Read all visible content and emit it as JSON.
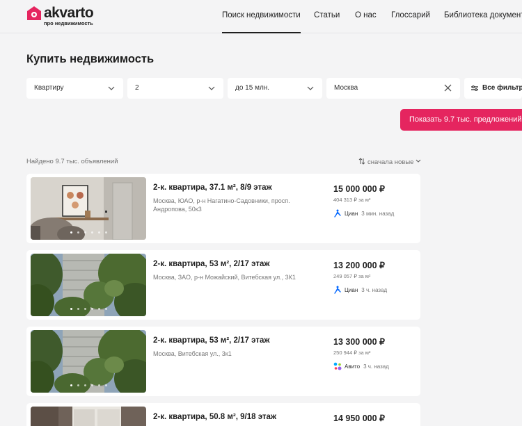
{
  "header": {
    "logo_text": "akvarto",
    "logo_sub": "про недвижимость",
    "nav": [
      "Поиск недвижимости",
      "Статьи",
      "О нас",
      "Глоссарий",
      "Библиотека документо"
    ]
  },
  "page_title": "Купить недвижимость",
  "filters": {
    "type": "Квартиру",
    "rooms": "2",
    "price": "до 15 млн.",
    "city": "Москва",
    "all_filters": "Все фильтры"
  },
  "show_button": "Показать 9.7 тыс. предложений",
  "found_text": "Найдено 9.7 тыс. объявлений",
  "sort_label": "сначала новые",
  "colors": {
    "accent": "#e5255f",
    "cian": "#0468ff"
  },
  "listings": [
    {
      "title": "2-к. квартира, 37.1 м², 8/9 этаж",
      "address": "Москва, ЮАО, р-н Нагатино-Садовники, просп. Андропова, 50к3",
      "price": "15 000 000 ₽",
      "price_per_m2": "404 313 ₽ за м²",
      "source": "Циан",
      "time": "3 мин. назад",
      "source_icon": "cian-icon"
    },
    {
      "title": "2-к. квартира, 53 м², 2/17 этаж",
      "address": "Москва, ЗАО, р-н Можайский, Витебская ул., 3К1",
      "price": "13 200 000 ₽",
      "price_per_m2": "249 057 ₽ за м²",
      "source": "Циан",
      "time": "3 ч. назад",
      "source_icon": "cian-icon"
    },
    {
      "title": "2-к. квартира, 53 м², 2/17 этаж",
      "address": "Москва, Витебская ул., 3к1",
      "price": "13 300 000 ₽",
      "price_per_m2": "250 944 ₽ за м²",
      "source": "Авито",
      "time": "3 ч. назад",
      "source_icon": "avito-icon"
    },
    {
      "title": "2-к. квартира, 50.8 м², 9/18 этаж",
      "price": "14 950 000 ₽"
    }
  ]
}
